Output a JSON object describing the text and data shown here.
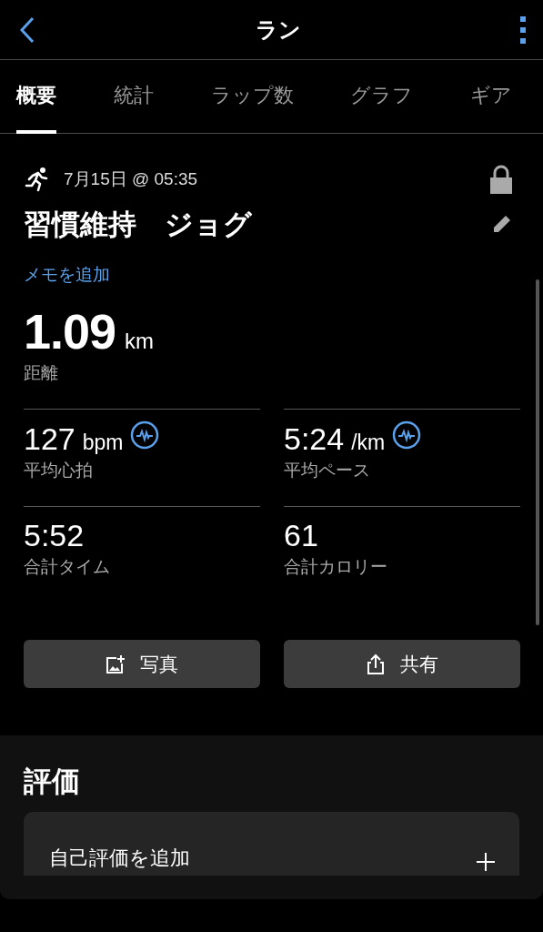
{
  "header": {
    "title": "ラン"
  },
  "tabs": [
    {
      "label": "概要",
      "selected": true
    },
    {
      "label": "統計",
      "selected": false
    },
    {
      "label": "ラップ数",
      "selected": false
    },
    {
      "label": "グラフ",
      "selected": false
    },
    {
      "label": "ギア",
      "selected": false
    }
  ],
  "activity": {
    "date": "7月15日 @ 05:35",
    "name": "習慣維持　ジョグ",
    "add_note": "メモを追加"
  },
  "distance": {
    "value": "1.09",
    "unit": "km",
    "label": "距離"
  },
  "stats": [
    {
      "value": "127",
      "unit": "bpm",
      "label": "平均心拍",
      "chart_link": true
    },
    {
      "value": "5:24",
      "unit": "/km",
      "label": "平均ペース",
      "chart_link": true
    },
    {
      "value": "5:52",
      "label": "合計タイム",
      "chart_link": false
    },
    {
      "value": "61",
      "label": "合計カロリー",
      "chart_link": false
    }
  ],
  "buttons": [
    {
      "kind": "photo",
      "label": "写真"
    },
    {
      "kind": "share",
      "label": "共有"
    }
  ],
  "rating": {
    "title": "評価",
    "add_label": "自己評価を追加"
  }
}
